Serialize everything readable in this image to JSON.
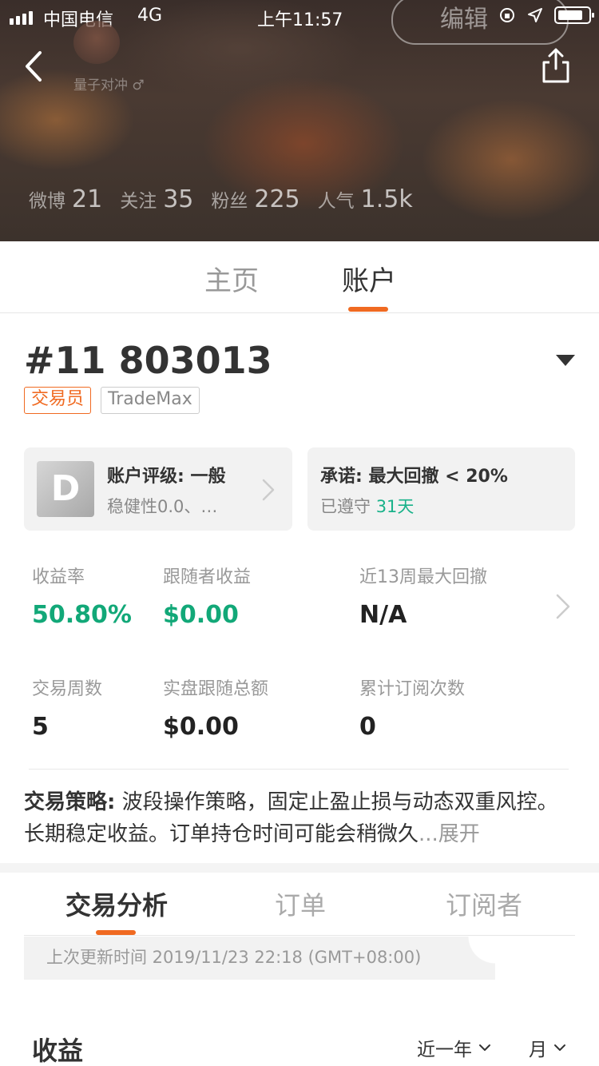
{
  "status_bar": {
    "carrier": "中国电信",
    "network": "4G",
    "time": "上午11:57"
  },
  "header": {
    "edit_label": "编辑",
    "username": "量子对冲 ♂",
    "stats": [
      {
        "label": "微博",
        "value": "21"
      },
      {
        "label": "关注",
        "value": "35"
      },
      {
        "label": "粉丝",
        "value": "225"
      },
      {
        "label": "人气",
        "value": "1.5k"
      }
    ]
  },
  "tabs": {
    "home": "主页",
    "account": "账户"
  },
  "account": {
    "id": "#11 803013",
    "tag_role": "交易员",
    "tag_broker": "TradeMax",
    "rating": {
      "grade": "D",
      "title": "账户评级: 一般",
      "subtitle": "稳健性0.0、…"
    },
    "promise": {
      "title": "承诺: 最大回撤 < 20%",
      "subtitle": "已遵守",
      "days": "31天"
    }
  },
  "metrics": {
    "return_label": "收益率",
    "return_value": "50.80%",
    "follower_income_label": "跟随者收益",
    "follower_income_value": "$0.00",
    "max_drawdown_label": "近13周最大回撤",
    "max_drawdown_value": "N/A",
    "weeks_label": "交易周数",
    "weeks_value": "5",
    "live_follow_label": "实盘跟随总额",
    "live_follow_value": "$0.00",
    "subs_label": "累计订阅次数",
    "subs_value": "0"
  },
  "strategy": {
    "label": "交易策略:",
    "text": " 波段操作策略，固定止盈止损与动态双重风控。长期稳定收益。订单持仓时间可能会稍微久",
    "more": "...展开"
  },
  "sub_tabs": {
    "analysis": "交易分析",
    "orders": "订单",
    "subscribers": "订阅者"
  },
  "update_text": "上次更新时间 2019/11/23 22:18 (GMT+08:00)",
  "income": {
    "title": "收益",
    "range": "近一年",
    "period": "月"
  }
}
